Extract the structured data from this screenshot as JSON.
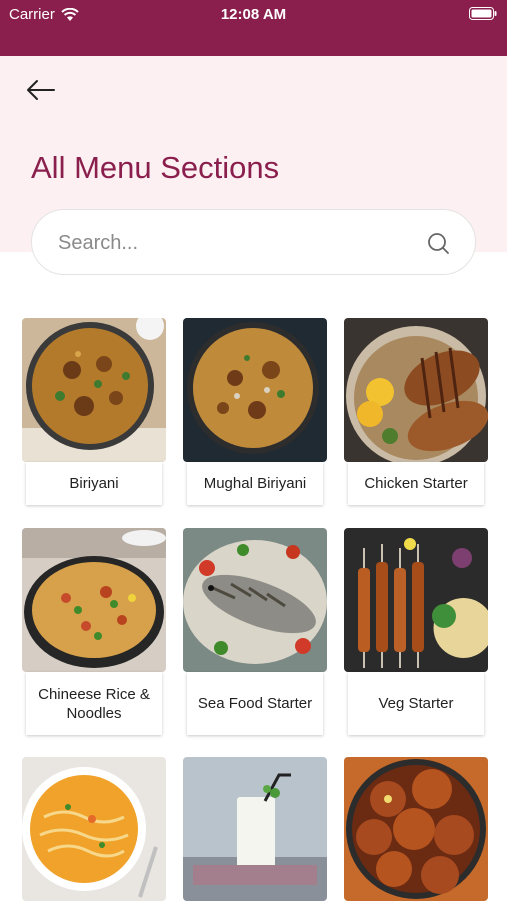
{
  "status_bar": {
    "carrier": "Carrier",
    "time": "12:08 AM"
  },
  "header": {
    "title": "All Menu Sections"
  },
  "search": {
    "placeholder": "Search..."
  },
  "sections": [
    {
      "label": "Biriyani",
      "image": "biriyani-pan"
    },
    {
      "label": "Mughal Biriyani",
      "image": "mughal-biriyani-pan"
    },
    {
      "label": "Chicken Starter",
      "image": "grilled-chicken-bowl"
    },
    {
      "label": "Chineese Rice & Noodles",
      "image": "fried-rice-bowl"
    },
    {
      "label": "Sea Food Starter",
      "image": "grilled-fish-platter"
    },
    {
      "label": "Veg Starter",
      "image": "paneer-skewers"
    },
    {
      "label": "",
      "image": "noodle-soup-bowl"
    },
    {
      "label": "",
      "image": "milk-glass"
    },
    {
      "label": "",
      "image": "gulab-jamun-bowl"
    }
  ],
  "colors": {
    "brand": "#8a1f4d",
    "header_bg": "#fcf0f2"
  }
}
